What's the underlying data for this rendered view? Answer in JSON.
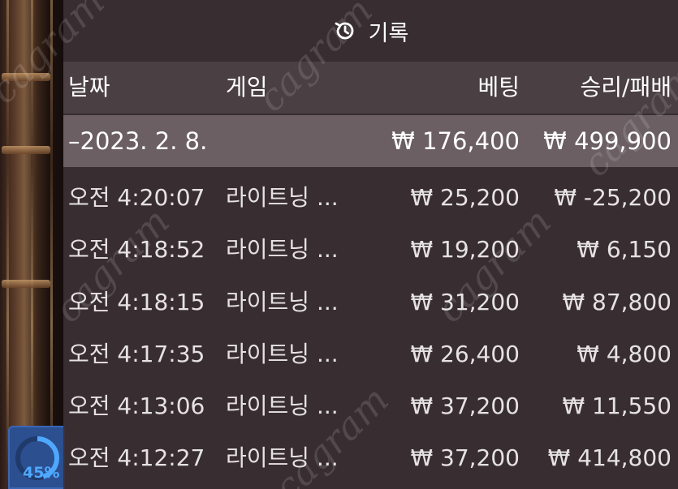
{
  "header": {
    "title": "기록",
    "icon": "history-icon"
  },
  "columns": {
    "date": "날짜",
    "game": "게임",
    "bet": "베팅",
    "win_loss": "승리/패배"
  },
  "summary": {
    "date": "–2023. 2. 8.",
    "bet": "₩ 176,400",
    "win_loss": "₩ 499,900"
  },
  "rows": [
    {
      "time": "오전 4:20:07",
      "game": "라이트닝 ...",
      "bet": "₩ 25,200",
      "win_loss": "₩ -25,200"
    },
    {
      "time": "오전 4:18:52",
      "game": "라이트닝 ...",
      "bet": "₩ 19,200",
      "win_loss": "₩ 6,150"
    },
    {
      "time": "오전 4:18:15",
      "game": "라이트닝 ...",
      "bet": "₩ 31,200",
      "win_loss": "₩ 87,800"
    },
    {
      "time": "오전 4:17:35",
      "game": "라이트닝 ...",
      "bet": "₩ 26,400",
      "win_loss": "₩ 4,800"
    },
    {
      "time": "오전 4:13:06",
      "game": "라이트닝 ...",
      "bet": "₩ 37,200",
      "win_loss": "₩ 11,550"
    },
    {
      "time": "오전 4:12:27",
      "game": "라이트닝 ...",
      "bet": "₩ 37,200",
      "win_loss": "₩ 414,800"
    }
  ],
  "progress": {
    "label": "45%",
    "value": 0.45,
    "color": "#4fa8ff"
  },
  "watermark": {
    "text": "cagram"
  },
  "colors": {
    "panel_bg": "#3a3034",
    "summary_bg": "#6e6266",
    "text": "#ffffff"
  }
}
